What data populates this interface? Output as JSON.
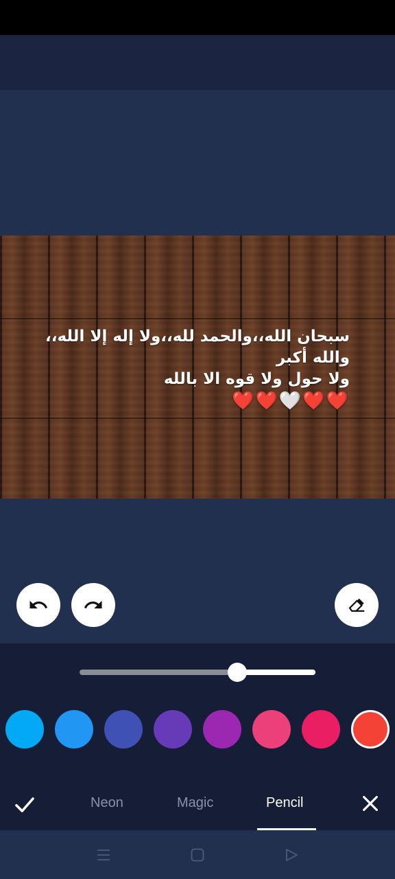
{
  "editor": {
    "caption_lines": [
      "سبحان الله،،والحمد لله،،ولا إله إلا الله،،",
      "والله أكبر",
      "ولا حول ولا قوه الا بالله",
      "❤️❤️🤍❤️❤️"
    ]
  },
  "toolbar": {
    "undo_icon": "undo-icon",
    "redo_icon": "redo-icon",
    "eraser_icon": "eraser-icon"
  },
  "brush": {
    "size_fraction": 0.67
  },
  "palette": {
    "colors": [
      "#03a9f4",
      "#2196f3",
      "#3f51b5",
      "#673ab7",
      "#9c27b0",
      "#ec407a",
      "#e91e63",
      "#f44336"
    ],
    "selected_index": 7
  },
  "tabs": {
    "confirm_icon": "check-icon",
    "items": [
      "Neon",
      "Magic",
      "Pencil"
    ],
    "active": "Pencil",
    "close_icon": "close-icon"
  },
  "navbar": {
    "icons": [
      "menu-icon",
      "home-icon",
      "back-icon"
    ]
  }
}
